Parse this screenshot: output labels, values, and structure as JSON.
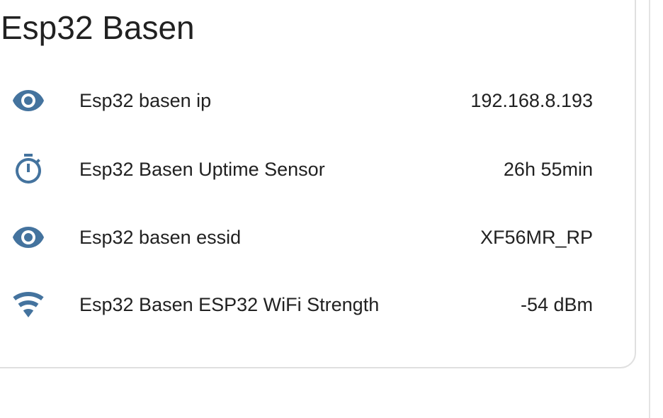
{
  "card": {
    "title": "Esp32 Basen",
    "icon_color": "#44739e",
    "entities": [
      {
        "name": "Esp32 basen ip",
        "state": "192.168.8.193",
        "icon": "eye-icon"
      },
      {
        "name": "Esp32 Basen Uptime Sensor",
        "state": "26h 55min",
        "icon": "timer-icon"
      },
      {
        "name": "Esp32 basen essid",
        "state": "XF56MR_RP",
        "icon": "eye-icon"
      },
      {
        "name": "Esp32 Basen ESP32 WiFi Strength",
        "state": "-54 dBm",
        "icon": "wifi-icon"
      }
    ]
  }
}
